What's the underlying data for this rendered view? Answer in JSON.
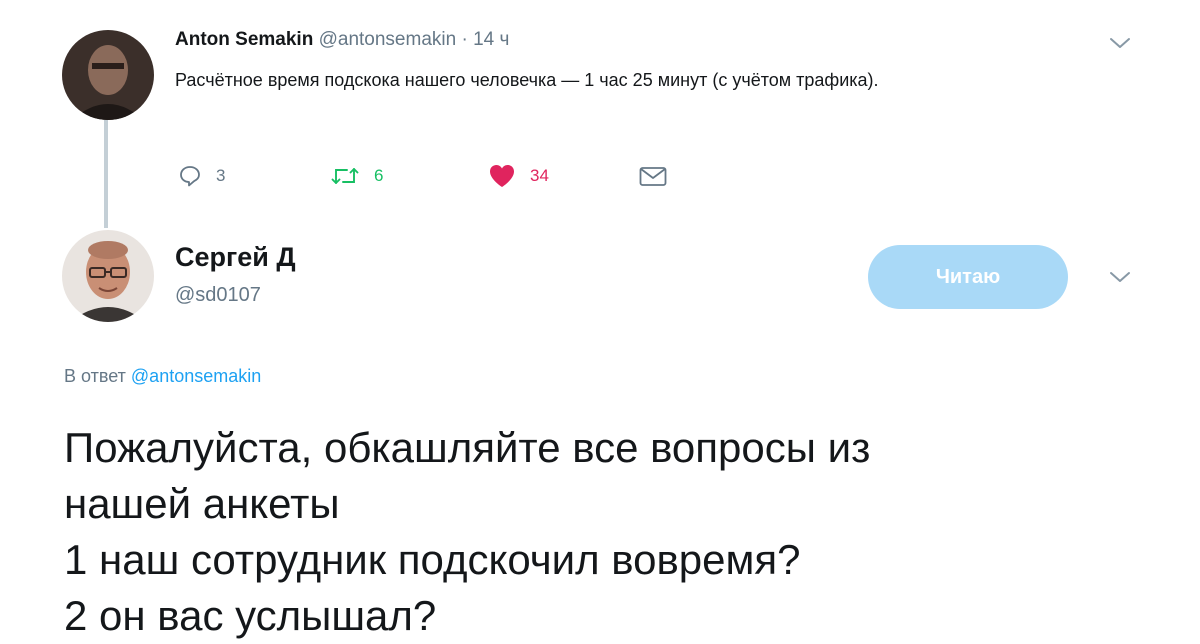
{
  "tweet1": {
    "author_name": "Anton Semakin",
    "author_handle": "@antonsemakin",
    "separator": "·",
    "time": "14 ч",
    "text": "Расчётное время подскока нашего человечка — 1 час 25 минут (с учётом трафика).",
    "actions": {
      "reply_count": "3",
      "retweet_count": "6",
      "like_count": "34"
    }
  },
  "tweet2": {
    "author_name": "Сергей Д",
    "author_handle": "@sd0107",
    "follow_label": "Читаю",
    "reply_prefix": "В ответ",
    "reply_mention": "@antonsemakin",
    "text_lines": [
      "Пожалуйста, обкашляйте все вопросы из",
      "нашей анкеты",
      "1 наш сотрудник подскочил вовремя?",
      "2 он вас услышал?"
    ]
  },
  "icons": {
    "reply": "reply-icon",
    "retweet": "retweet-icon",
    "like": "heart-icon",
    "dm": "envelope-icon",
    "menu": "chevron-down-icon"
  },
  "colors": {
    "text": "#14171a",
    "secondary": "#657786",
    "link": "#1da1f2",
    "retweet": "#17bf63",
    "like": "#e0245e",
    "follow_button": "#a9d9f7"
  }
}
